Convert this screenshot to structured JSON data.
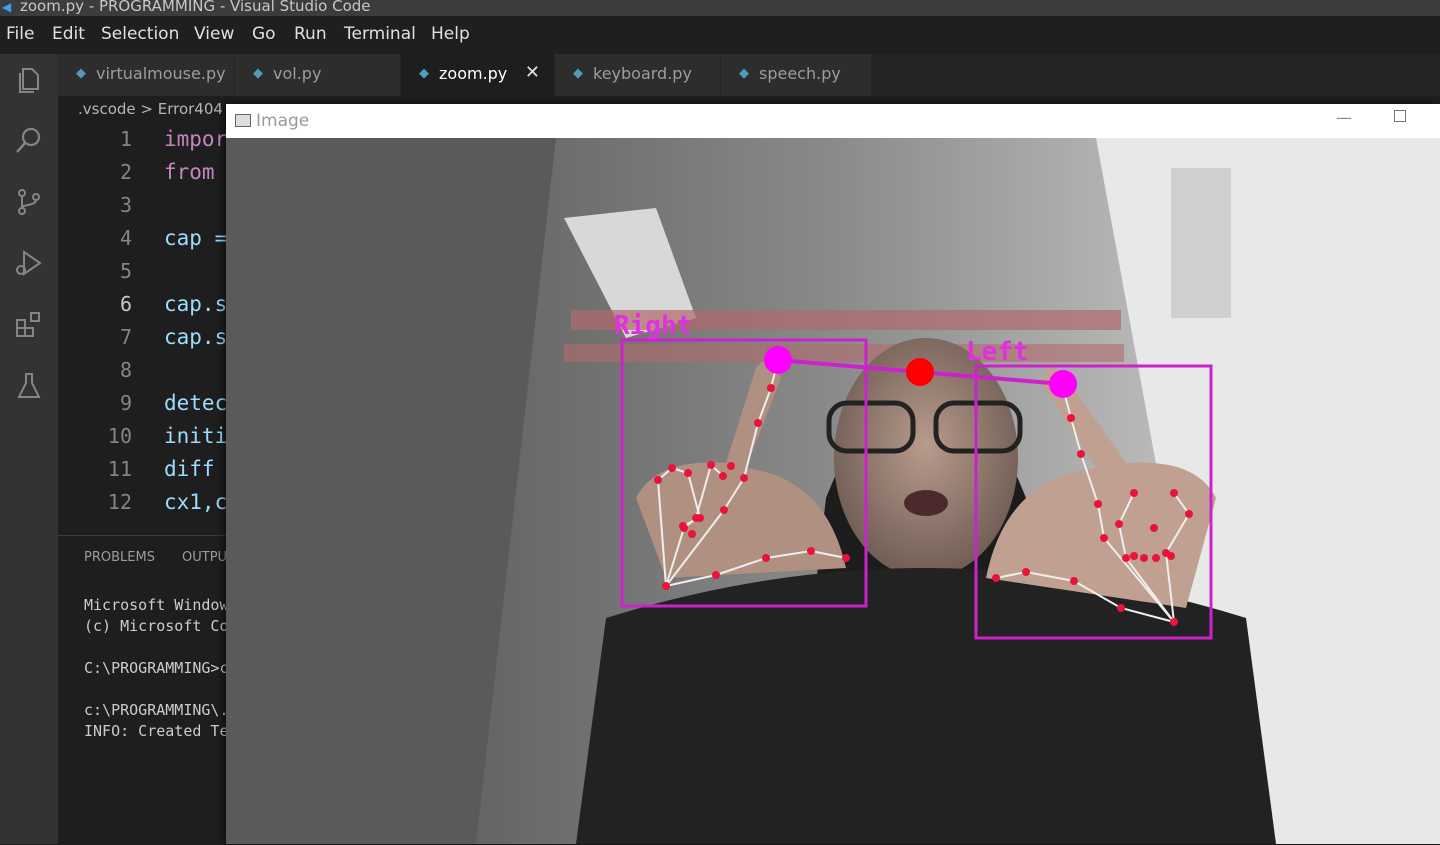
{
  "window": {
    "title": "zoom.py - PROGRAMMING - Visual Studio Code"
  },
  "menu": [
    "File",
    "Edit",
    "Selection",
    "View",
    "Go",
    "Run",
    "Terminal",
    "Help"
  ],
  "activity_icons": [
    "explorer-icon",
    "search-icon",
    "source-control-icon",
    "run-debug-icon",
    "extensions-icon",
    "testing-icon"
  ],
  "tabs": [
    {
      "label": "virtualmouse.py",
      "active": false
    },
    {
      "label": "vol.py",
      "active": false
    },
    {
      "label": "zoom.py",
      "active": true,
      "close": "✕"
    },
    {
      "label": "keyboard.py",
      "active": false
    },
    {
      "label": "speech.py",
      "active": false
    }
  ],
  "breadcrumb": ".vscode > Error404 >",
  "editor": {
    "lines": [
      {
        "num": "1",
        "text": "impor",
        "color": "#c586c0"
      },
      {
        "num": "2",
        "text": "from",
        "color": "#c586c0"
      },
      {
        "num": "3",
        "text": "",
        "color": "#9cdcfe"
      },
      {
        "num": "4",
        "text": "cap =",
        "color": "#9cdcfe"
      },
      {
        "num": "5",
        "text": "",
        "color": "#9cdcfe"
      },
      {
        "num": "6",
        "text": "cap.s",
        "color": "#9cdcfe"
      },
      {
        "num": "7",
        "text": "cap.s",
        "color": "#9cdcfe"
      },
      {
        "num": "8",
        "text": "",
        "color": "#9cdcfe"
      },
      {
        "num": "9",
        "text": "detec",
        "color": "#9cdcfe"
      },
      {
        "num": "10",
        "text": "initi",
        "color": "#9cdcfe"
      },
      {
        "num": "11",
        "text": "diff",
        "color": "#9cdcfe"
      },
      {
        "num": "12",
        "text": "cx1,c",
        "color": "#9cdcfe"
      }
    ]
  },
  "panel": {
    "tabs": [
      "PROBLEMS",
      "OUTPU"
    ],
    "terminal": [
      "Microsoft Window",
      "(c) Microsoft Co",
      "C:\\PROGRAMMING>c",
      "c:\\PROGRAMMING\\.",
      "INFO: Created Te"
    ]
  },
  "image_window": {
    "title": "Image",
    "minimize": "—",
    "labels": {
      "right": "Right",
      "left": "Left"
    },
    "colors": {
      "box": "#cc22cc",
      "landmark": "#e8143c",
      "center": "#ff0000",
      "tip": "#ff00ff"
    }
  }
}
